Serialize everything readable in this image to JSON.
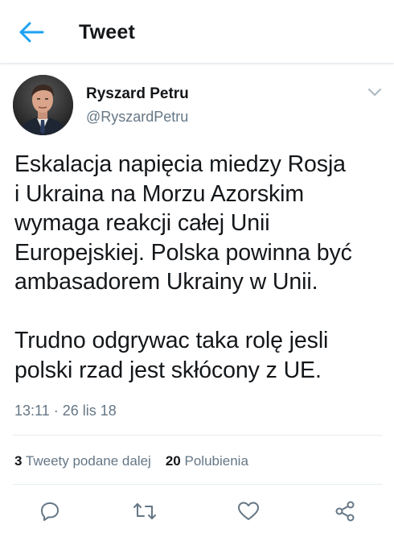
{
  "header": {
    "back_icon": "arrow-left-icon",
    "title": "Tweet"
  },
  "author": {
    "name": "Ryszard Petru",
    "handle": "@RyszardPetru",
    "menu_icon": "chevron-down-icon"
  },
  "tweet": {
    "text": "Eskalacja napięcia miedzy Rosja\ni Ukraina na Morzu Azorskim\nwymaga reakcji całej Unii\nEuropejskiej. Polska powinna być\nambasadorem Ukrainy w Unii.\n\nTrudno odgrywac taka rolę jesli\npolski rzad jest skłócony z UE.",
    "timestamp": "13:11 · 26 lis 18"
  },
  "stats": {
    "retweets_count": "3",
    "retweets_label": "Tweety podane dalej",
    "likes_count": "20",
    "likes_label": "Polubienia"
  },
  "actions": [
    {
      "icon": "reply-icon"
    },
    {
      "icon": "retweet-icon"
    },
    {
      "icon": "like-icon"
    },
    {
      "icon": "share-icon"
    }
  ],
  "colors": {
    "accent": "#1da1f2",
    "text": "#14171a",
    "secondary_text": "#657786",
    "divider": "#e6ecf0"
  }
}
